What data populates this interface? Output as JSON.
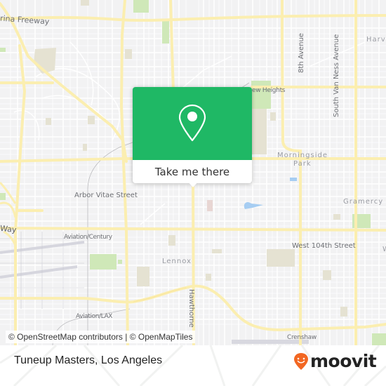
{
  "map": {
    "labels": {
      "freeway": "rina Freeway",
      "eighth_avenue": "8th Avenue",
      "south_van_ness": "South Van Ness Avenue",
      "harvard": "Harva",
      "view_heights": "ew Heights",
      "morningside_park": "Morningside\nPark",
      "morningside": "Morningside",
      "park": "Park",
      "arbor_vitae": "Arbor Vitae Street",
      "gramercy": "Gramercy P",
      "way": "Way",
      "aviation_century": "Aviation/Century",
      "west_104th": "West 104th Street",
      "west_cut": "W",
      "lennox": "Lennox",
      "hawthorne": "Hawthorne",
      "aviation_lax": "Aviation/LAX",
      "crenshaw": "Crenshaw"
    },
    "colors": {
      "background": "#f2f2f3",
      "major_road": "#fbeeb0",
      "minor_road": "#ffffff",
      "park": "#cfe8b8",
      "park_dark": "#a8d98c",
      "landuse": "#e5e2d2",
      "water": "#a6cdf2",
      "rail": "#b9b9bd"
    }
  },
  "popup": {
    "icon": "map-pin-icon",
    "action_label": "Take me there",
    "color": "#1fb865"
  },
  "attribution": {
    "osm": "© OpenStreetMap contributors",
    "separator": " | ",
    "omt": "© OpenMapTiles"
  },
  "footer": {
    "place_title": "Tuneup Masters, Los Angeles",
    "brand": {
      "name": "moovit",
      "logo_icon": "moovit-smile-pin-icon",
      "logo_color": "#f26722"
    }
  }
}
